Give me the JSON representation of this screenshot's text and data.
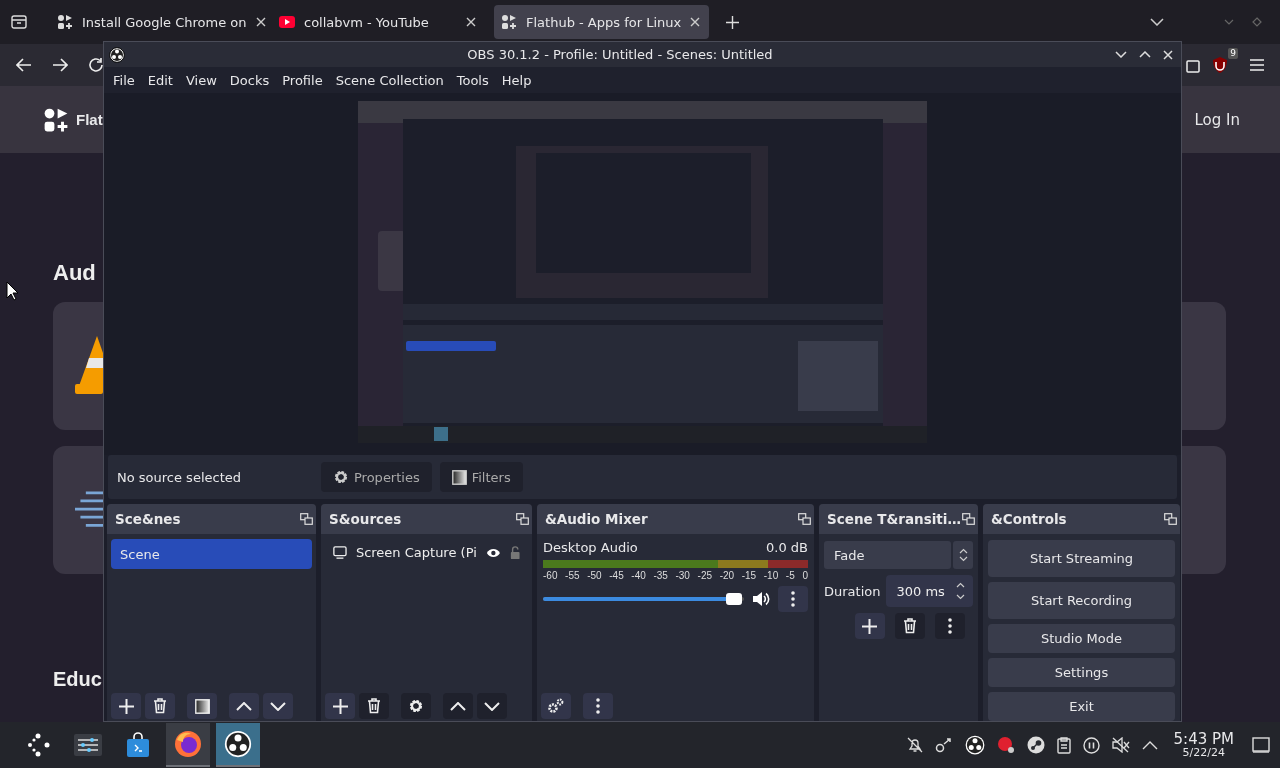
{
  "browser": {
    "tabs": [
      {
        "title": "Install Google Chrome on",
        "selected": false,
        "kind": "flathub"
      },
      {
        "title": "collabvm - YouTube",
        "selected": false,
        "kind": "youtube"
      },
      {
        "title": "Flathub - Apps for Linux",
        "selected": true,
        "kind": "flathub"
      }
    ],
    "extension_badge": "9",
    "page": {
      "brand": "Flat",
      "login": "Log In",
      "sections": [
        {
          "heading": "Aud",
          "cards": [
            {
              "kind": "cone"
            },
            {
              "kind": "lines"
            }
          ]
        },
        {
          "heading": "Educ"
        }
      ]
    }
  },
  "obs": {
    "title": "OBS 30.1.2 - Profile: Untitled - Scenes: Untitled",
    "menu": [
      "File",
      "Edit",
      "View",
      "Docks",
      "Profile",
      "Scene Collection",
      "Tools",
      "Help"
    ],
    "preview": {
      "kind": "picture"
    },
    "status": "No source selected",
    "properties": "Properties",
    "filters": "Filters",
    "scenes": {
      "title": "Sce&nes",
      "items": [
        {
          "label": "Scene",
          "selected": true
        }
      ]
    },
    "sources": {
      "title": "S&ources",
      "items": [
        {
          "label": "Screen Capture (Pi",
          "visible": true,
          "locked": false
        }
      ]
    },
    "mixer": {
      "title": "&Audio Mixer",
      "channels": [
        {
          "name": "Desktop Audio",
          "reading": "0.0 dB",
          "level": 0.95,
          "muted": false
        }
      ],
      "scale": [
        "-60",
        "-55",
        "-50",
        "-45",
        "-40",
        "-35",
        "-30",
        "-25",
        "-20",
        "-15",
        "-10",
        "-5",
        "0"
      ]
    },
    "transitions": {
      "title": "Scene T&ransiti…",
      "transition": "Fade",
      "duration_label": "Duration",
      "duration": "300 ms"
    },
    "controls": {
      "title": "&Controls",
      "buttons": [
        "Start Streaming",
        "Start Recording",
        "Studio Mode",
        "Settings",
        "Exit"
      ]
    }
  },
  "taskbar": {
    "apps": [
      {
        "kind": "launcher",
        "active": false,
        "open": false
      },
      {
        "kind": "mixer",
        "active": false,
        "open": false
      },
      {
        "kind": "store",
        "active": false,
        "open": false
      },
      {
        "kind": "firefox",
        "active": false,
        "open": true
      },
      {
        "kind": "obs",
        "active": true,
        "open": true
      }
    ],
    "tray": [
      {
        "kind": "bell-off"
      },
      {
        "kind": "network"
      },
      {
        "kind": "obs"
      },
      {
        "kind": "record"
      },
      {
        "kind": "steam"
      },
      {
        "kind": "clipboard"
      },
      {
        "kind": "pause"
      },
      {
        "kind": "volume-muted"
      },
      {
        "kind": "expand"
      }
    ],
    "time": "5:43 PM",
    "date": "5/22/24"
  }
}
